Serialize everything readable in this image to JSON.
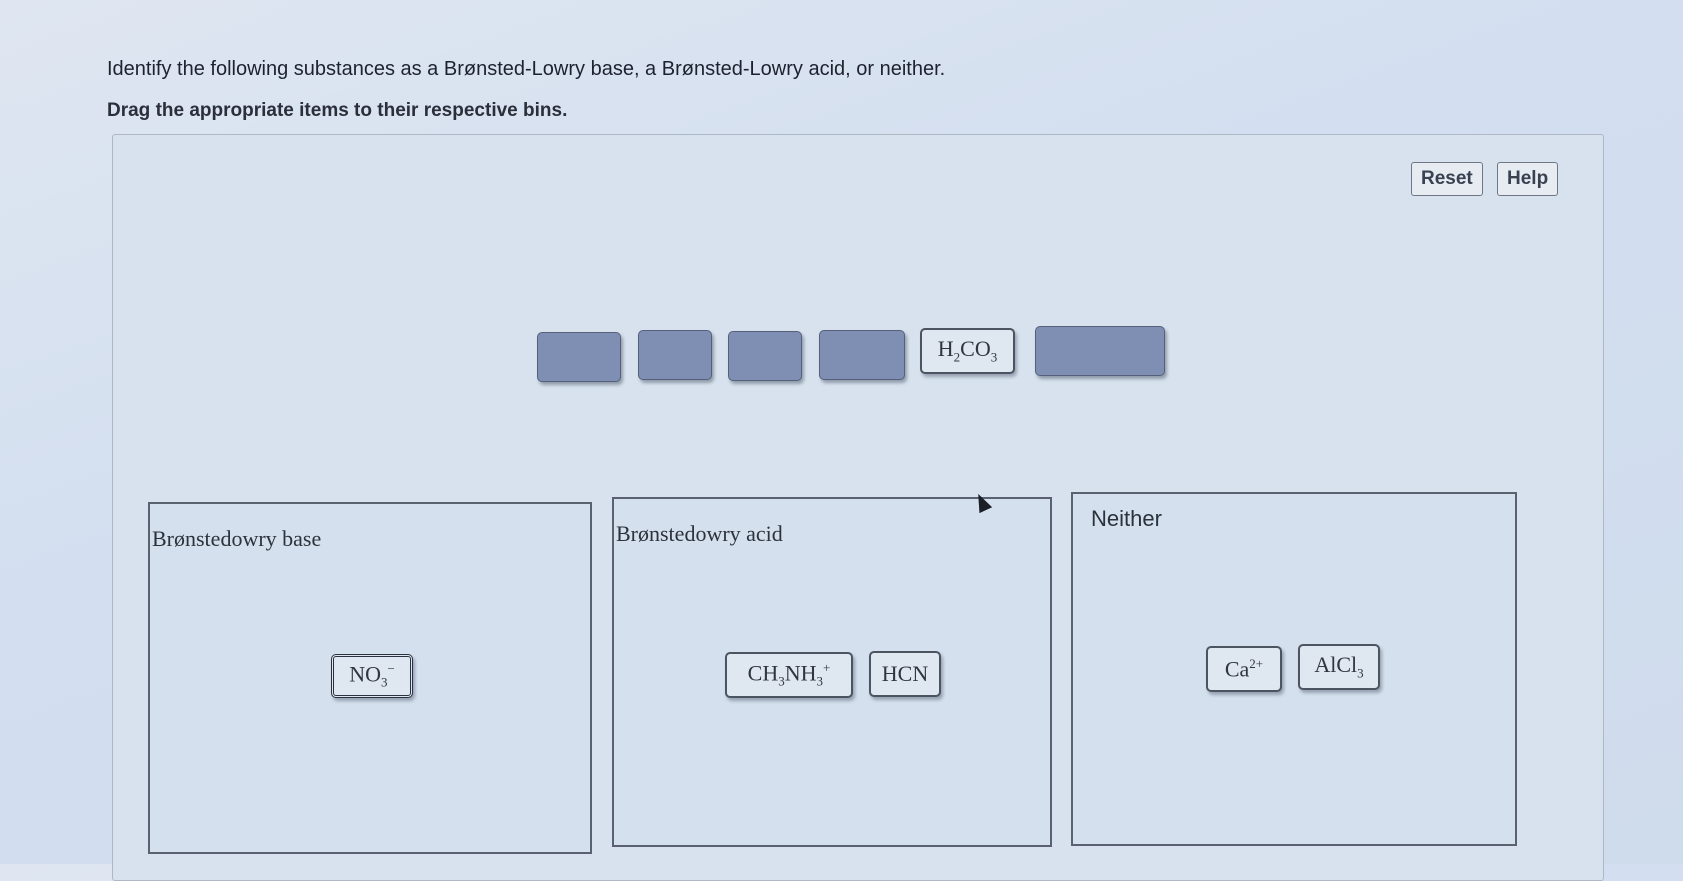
{
  "instructions": {
    "line1": "Identify the following substances as a Brønsted-Lowry base, a Brønsted-Lowry acid, or neither.",
    "line2": "Drag the appropriate items to their respective bins."
  },
  "toolbar": {
    "reset_label": "Reset",
    "help_label": "Help"
  },
  "pool": {
    "h2co3": {
      "base": "H",
      "sub1": "2",
      "mid": "CO",
      "sub2": "3"
    }
  },
  "bins": {
    "base": {
      "title": "Brønstedowry base",
      "items": {
        "no3": {
          "base": "NO",
          "sub": "3",
          "sup": "−"
        }
      }
    },
    "acid": {
      "title": "Brønstedowry acid",
      "items": {
        "ch3nh3": {
          "a": "CH",
          "s1": "3",
          "b": "NH",
          "s2": "3",
          "sup": "+"
        },
        "hcn": {
          "label": "HCN"
        }
      }
    },
    "neither": {
      "title": "Neither",
      "items": {
        "ca": {
          "base": "Ca",
          "sup": "2+"
        },
        "alcl3": {
          "base": "AlCl",
          "sub": "3"
        }
      }
    }
  }
}
